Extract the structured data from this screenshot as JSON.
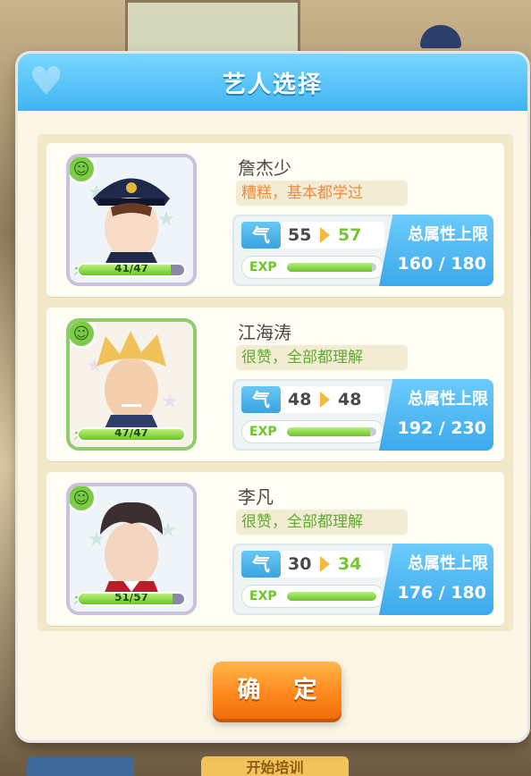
{
  "dialog": {
    "title": "艺人选择",
    "confirm_label": "确 定"
  },
  "background": {
    "bottom_button_text": "开始培训"
  },
  "artists": [
    {
      "name": "詹杰少",
      "comment": "糟糕，基本都学过",
      "comment_color": "orange",
      "qi_current": "55",
      "qi_next": "57",
      "qi_trend": "up",
      "exp_fraction": 0.95,
      "max_label": "总属性上限",
      "max_value": "160 / 180",
      "energy": "41/47",
      "energy_fraction": 0.87,
      "frame": "gray"
    },
    {
      "name": "江海涛",
      "comment": "很赞，全部都理解",
      "comment_color": "green",
      "qi_current": "48",
      "qi_next": "48",
      "qi_trend": "same",
      "exp_fraction": 0.93,
      "max_label": "总属性上限",
      "max_value": "192 / 230",
      "energy": "47/47",
      "energy_fraction": 1.0,
      "frame": "green"
    },
    {
      "name": "李凡",
      "comment": "很赞，全部都理解",
      "comment_color": "green",
      "qi_current": "30",
      "qi_next": "34",
      "qi_trend": "up",
      "exp_fraction": 1.0,
      "max_label": "总属性上限",
      "max_value": "176 / 180",
      "energy": "51/57",
      "energy_fraction": 0.89,
      "frame": "gray"
    }
  ],
  "icons": {
    "qi": "气",
    "mood": "smile-icon",
    "bolt": "bolt-icon",
    "exp_label": "EXP"
  }
}
